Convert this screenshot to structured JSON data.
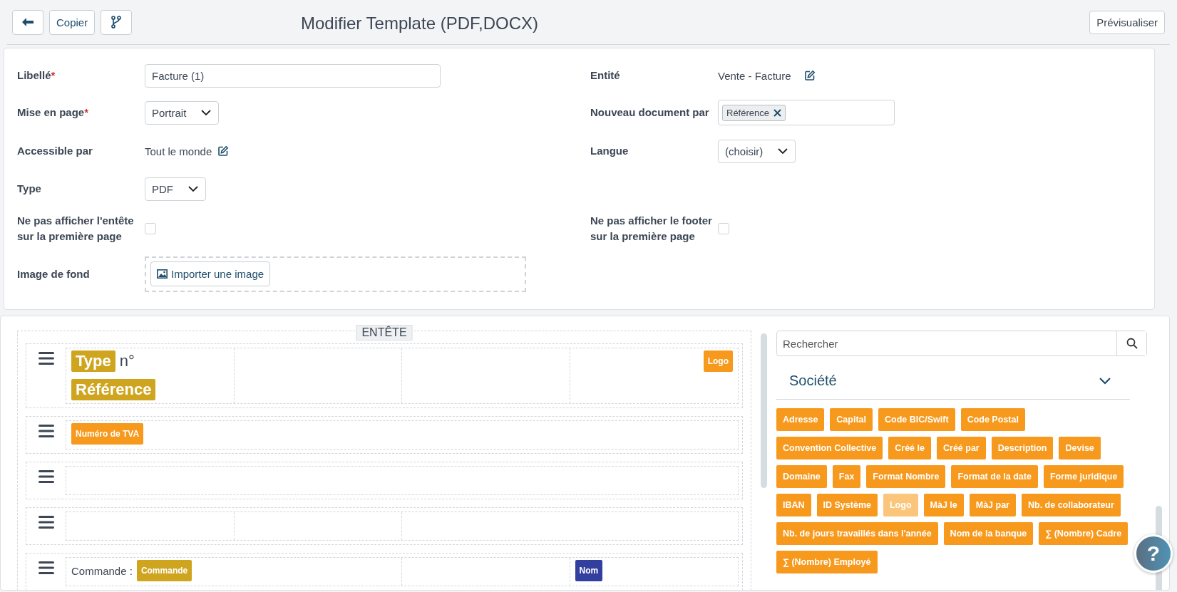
{
  "toolbar": {
    "buttons": [
      {
        "kind": "back"
      },
      {
        "kind": "text",
        "label": "Copier"
      },
      {
        "kind": "branch"
      }
    ],
    "title": "Modifier Template (PDF,DOCX)",
    "preview_button": "Prévisualiser"
  },
  "form": {
    "rows": [
      {
        "left": {
          "label": "Libellé",
          "required_mark": "*",
          "kind": "input",
          "value": "Facture (1)"
        },
        "right": {
          "label": "Entité",
          "kind": "static-edit",
          "value": "Vente - Facture"
        }
      },
      {
        "left": {
          "label": "Mise en page",
          "required_mark": "*",
          "kind": "select",
          "value": "Portrait"
        },
        "right": {
          "label": "Nouveau document par",
          "kind": "chips",
          "chips": [
            "Référence"
          ]
        }
      },
      {
        "left": {
          "label": "Accessible par",
          "kind": "static-edit",
          "value": "Tout le monde"
        },
        "right": {
          "label": "Langue",
          "kind": "select",
          "value": "(choisir)"
        }
      },
      {
        "left": {
          "label": "Type",
          "kind": "select",
          "value": "PDF"
        }
      },
      {
        "left": {
          "label": "Ne pas afficher l'entête sur la première page",
          "kind": "checkbox",
          "checked": false
        },
        "right": {
          "label": "Ne pas afficher le footer sur la première page",
          "kind": "checkbox",
          "checked": false
        }
      },
      {
        "left": {
          "label": "Image de fond",
          "kind": "upload",
          "button": "Importer une image"
        }
      }
    ]
  },
  "editor": {
    "section_title": "ENTÊTE",
    "rows": [
      {
        "kind": "quarters",
        "cells": [
          {
            "kind": "content",
            "items": [
              {
                "kind": "tag-large",
                "text": "Type",
                "color": "#cfa51f"
              },
              {
                "kind": "text-large",
                "text": "n°"
              },
              {
                "kind": "break"
              },
              {
                "kind": "tag-large",
                "text": "Référence",
                "color": "#cfa51f"
              }
            ]
          },
          {
            "kind": "empty"
          },
          {
            "kind": "empty"
          },
          {
            "kind": "content-end",
            "items": [
              {
                "kind": "tag",
                "text": "Logo",
                "color": "#f7991c"
              }
            ]
          }
        ]
      },
      {
        "kind": "single",
        "cells": [
          {
            "kind": "content",
            "items": [
              {
                "kind": "tag",
                "text": "Numéro de TVA",
                "color": "#f7991c"
              }
            ]
          }
        ]
      },
      {
        "kind": "single",
        "cells": [
          {
            "kind": "empty"
          }
        ]
      },
      {
        "kind": "quarter-quarter-half",
        "cells": [
          {
            "kind": "empty"
          },
          {
            "kind": "empty"
          },
          {
            "kind": "empty"
          }
        ]
      },
      {
        "kind": "half-quarter-quarter",
        "cells": [
          {
            "kind": "content",
            "items": [
              {
                "kind": "text",
                "text": "Commande :"
              },
              {
                "kind": "tag",
                "text": "Commande",
                "color": "#cfa51f"
              }
            ]
          },
          {
            "kind": "empty"
          },
          {
            "kind": "content",
            "items": [
              {
                "kind": "tag",
                "text": "Nom",
                "color": "#333f9e"
              }
            ]
          }
        ]
      }
    ]
  },
  "palette": {
    "search": {
      "placeholder": "Rechercher"
    },
    "group": {
      "title": "Société",
      "expanded": true,
      "tags": [
        {
          "label": "Adresse",
          "disabled": false
        },
        {
          "label": "Capital",
          "disabled": false
        },
        {
          "label": "Code BIC/Swift",
          "disabled": false
        },
        {
          "label": "Code Postal",
          "disabled": false
        },
        {
          "label": "Convention Collective",
          "disabled": false
        },
        {
          "label": "Créé le",
          "disabled": false
        },
        {
          "label": "Créé par",
          "disabled": false
        },
        {
          "label": "Description",
          "disabled": false
        },
        {
          "label": "Devise",
          "disabled": false
        },
        {
          "label": "Domaine",
          "disabled": false
        },
        {
          "label": "Fax",
          "disabled": false
        },
        {
          "label": "Format Nombre",
          "disabled": false
        },
        {
          "label": "Format de la date",
          "disabled": false
        },
        {
          "label": "Forme juridique",
          "disabled": false
        },
        {
          "label": "IBAN",
          "disabled": false
        },
        {
          "label": "ID Système",
          "disabled": false
        },
        {
          "label": "Logo",
          "disabled": true
        },
        {
          "label": "MàJ le",
          "disabled": false
        },
        {
          "label": "MàJ par",
          "disabled": false
        },
        {
          "label": "Nb. de collaborateur",
          "disabled": false
        },
        {
          "label": "Nb. de jours travaillés dans l'année",
          "disabled": false
        },
        {
          "label": "Nom de la banque",
          "disabled": false
        },
        {
          "label": "∑ (Nombre) Cadre",
          "disabled": false
        },
        {
          "label": "∑ (Nombre) Employé",
          "disabled": false
        }
      ]
    }
  },
  "help_button": "?"
}
